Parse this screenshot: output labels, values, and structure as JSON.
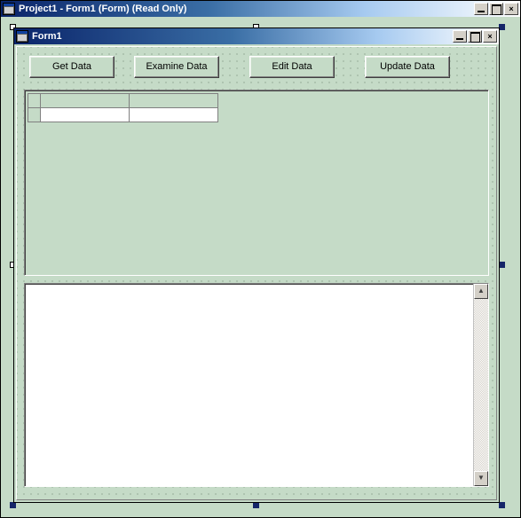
{
  "outerWindow": {
    "title": "Project1 - Form1 (Form)  (Read Only)"
  },
  "childWindow": {
    "title": "Form1"
  },
  "buttons": {
    "getData": "Get Data",
    "examineData": "Examine Data",
    "editData": "Edit Data",
    "updateData": "Update Data"
  }
}
